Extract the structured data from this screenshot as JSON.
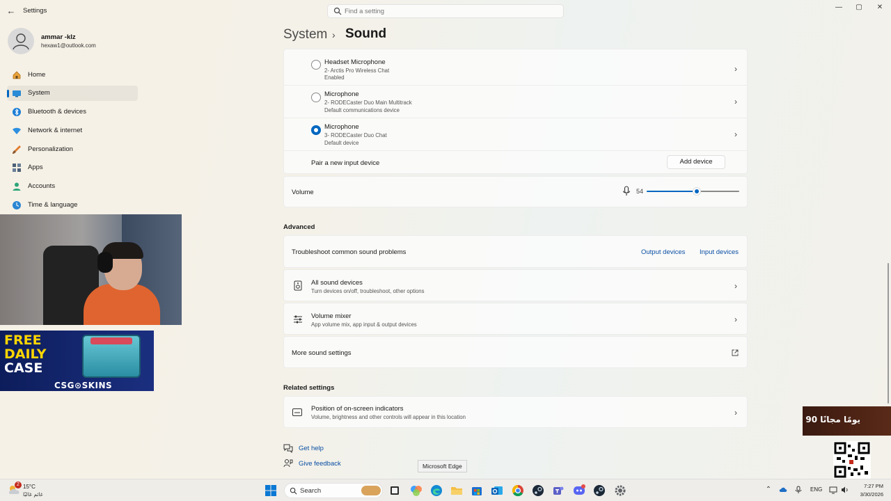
{
  "window": {
    "title": "Settings",
    "search_placeholder": "Find a setting",
    "minimize": "—",
    "maximize": "▢",
    "close": "✕"
  },
  "profile": {
    "name": "ammar -klz",
    "email": "hexaw1@outlook.com"
  },
  "nav": [
    {
      "label": "Home",
      "icon": "home-icon"
    },
    {
      "label": "System",
      "icon": "system-icon",
      "active": true
    },
    {
      "label": "Bluetooth & devices",
      "icon": "bluetooth-icon"
    },
    {
      "label": "Network & internet",
      "icon": "network-icon"
    },
    {
      "label": "Personalization",
      "icon": "brush-icon"
    },
    {
      "label": "Apps",
      "icon": "apps-icon"
    },
    {
      "label": "Accounts",
      "icon": "accounts-icon"
    },
    {
      "label": "Time & language",
      "icon": "time-language-icon"
    }
  ],
  "breadcrumb": {
    "parent": "System",
    "separator": "›",
    "current": "Sound"
  },
  "input_devices": [
    {
      "name": "Headset Microphone",
      "detail": "2- Arctis Pro Wireless Chat",
      "status": "Enabled",
      "selected": false
    },
    {
      "name": "Microphone",
      "detail": "2- RODECaster Duo Main Multitrack",
      "status": "Default communications device",
      "selected": false
    },
    {
      "name": "Microphone",
      "detail": "3- RODECaster Duo Chat",
      "status": "Default device",
      "selected": true
    }
  ],
  "pair": {
    "label": "Pair a new input device",
    "button": "Add device"
  },
  "volume": {
    "label": "Volume",
    "value": "54",
    "level": 0.54
  },
  "advanced": {
    "title": "Advanced",
    "troubleshoot": {
      "label": "Troubleshoot common sound problems",
      "output_link": "Output devices",
      "input_link": "Input devices"
    },
    "all_devices": {
      "label": "All sound devices",
      "sub": "Turn devices on/off, troubleshoot, other options"
    },
    "mixer": {
      "label": "Volume mixer",
      "sub": "App volume mix, app input & output devices"
    },
    "more": {
      "label": "More sound settings"
    }
  },
  "related": {
    "title": "Related settings",
    "indicators": {
      "label": "Position of on-screen indicators",
      "sub": "Volume, brightness and other controls will appear in this location"
    }
  },
  "help": {
    "get_help": "Get help",
    "feedback": "Give feedback"
  },
  "overlays": {
    "ad_line1": "FREE",
    "ad_line2": "DAILY",
    "ad_line3": "CASE",
    "ad_brand": "CSG⊙SKINS",
    "ad2_text": "90 يومًا مجانًا"
  },
  "tooltip": "Microsoft Edge",
  "taskbar": {
    "weather_badge": "2",
    "temperature": "15°C",
    "weather_text": "غائم غالبًا",
    "search_label": "Search",
    "language": "ENG",
    "time": "7:27 PM",
    "date": "3/30/2026"
  },
  "colors": {
    "accent": "#0067c0",
    "link": "#0a4ea3"
  }
}
